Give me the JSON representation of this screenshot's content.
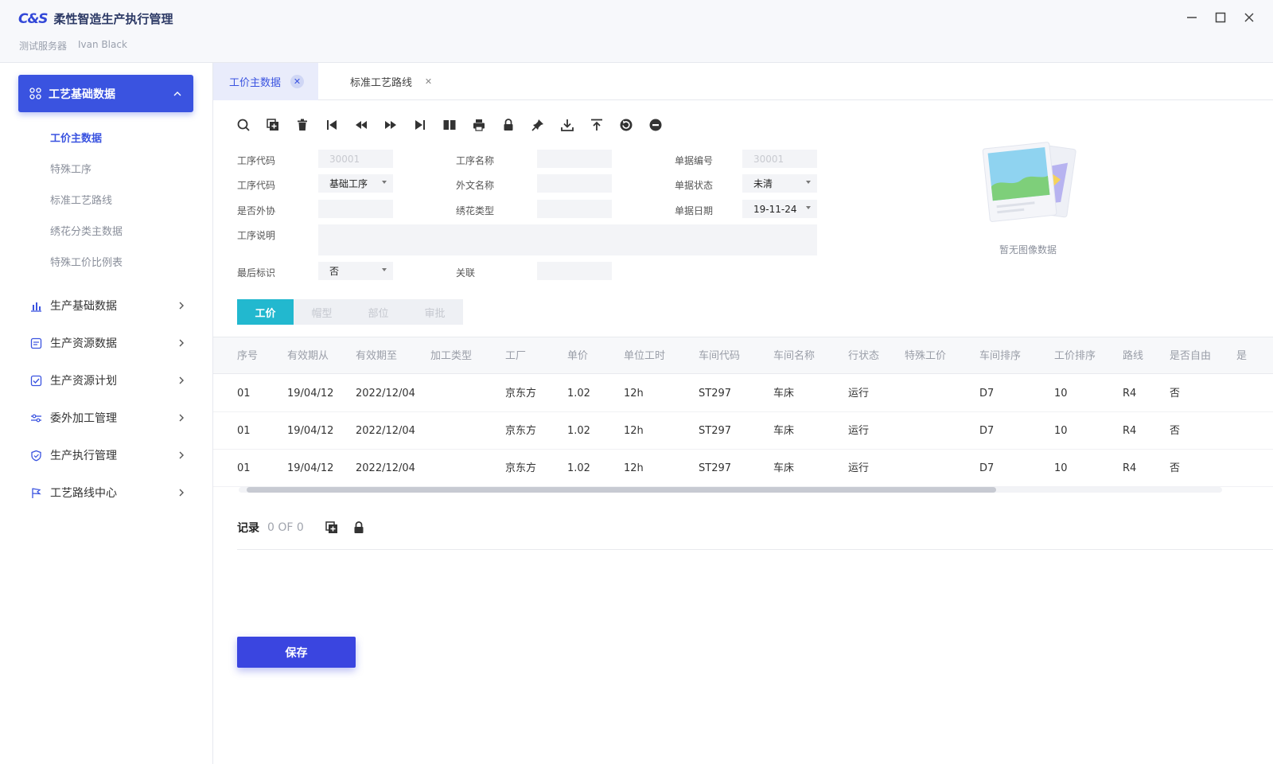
{
  "app": {
    "logo": "C&S",
    "title": "柔性智造生产执行管理",
    "server": "测试服务器",
    "user": "Ivan Black"
  },
  "sidebar": {
    "active_group": "工艺基础数据",
    "sub_items": [
      "工价主数据",
      "特殊工序",
      "标准工艺路线",
      "绣花分类主数据",
      "特殊工价比例表"
    ],
    "groups": [
      "生产基础数据",
      "生产资源数据",
      "生产资源计划",
      "委外加工管理",
      "生产执行管理",
      "工艺路线中心"
    ]
  },
  "tabs": [
    {
      "label": "工价主数据",
      "active": true
    },
    {
      "label": "标准工艺路线",
      "active": false
    }
  ],
  "form": {
    "process_code_label": "工序代码",
    "process_code_value": "30001",
    "process_code2_label": "工序代码",
    "process_code2_value": "基础工序",
    "outsource_label": "是否外协",
    "outsource_value": "",
    "description_label": "工序说明",
    "last_flag_label": "最后标识",
    "last_flag_value": "否",
    "process_name_label": "工序名称",
    "foreign_name_label": "外文名称",
    "embroidery_type_label": "绣花类型",
    "relation_label": "关联",
    "doc_no_label": "单据编号",
    "doc_no_value": "30001",
    "doc_status_label": "单据状态",
    "doc_status_value": "未清",
    "doc_date_label": "单据日期",
    "doc_date_value": "19-11-24"
  },
  "image_panel": {
    "caption": "暂无图像数据"
  },
  "subtabs": [
    "工价",
    "帽型",
    "部位",
    "审批"
  ],
  "table": {
    "columns": [
      "序号",
      "有效期从",
      "有效期至",
      "加工类型",
      "工厂",
      "单价",
      "单位工时",
      "车间代码",
      "车间名称",
      "行状态",
      "特殊工价",
      "车间排序",
      "工价排序",
      "路线",
      "是否自由",
      "是"
    ],
    "rows": [
      [
        "01",
        "19/04/12",
        "2022/12/04",
        "",
        "京东方",
        "1.02",
        "12h",
        "ST297",
        "车床",
        "运行",
        "",
        "D7",
        "10",
        "R4",
        "否",
        ""
      ],
      [
        "01",
        "19/04/12",
        "2022/12/04",
        "",
        "京东方",
        "1.02",
        "12h",
        "ST297",
        "车床",
        "运行",
        "",
        "D7",
        "10",
        "R4",
        "否",
        ""
      ],
      [
        "01",
        "19/04/12",
        "2022/12/04",
        "",
        "京东方",
        "1.02",
        "12h",
        "ST297",
        "车床",
        "运行",
        "",
        "D7",
        "10",
        "R4",
        "否",
        ""
      ]
    ]
  },
  "records": {
    "label": "记录",
    "count": "0 OF 0"
  },
  "save_label": "保存",
  "colors": {
    "primary": "#3a53e0",
    "teal": "#22b8cf"
  }
}
